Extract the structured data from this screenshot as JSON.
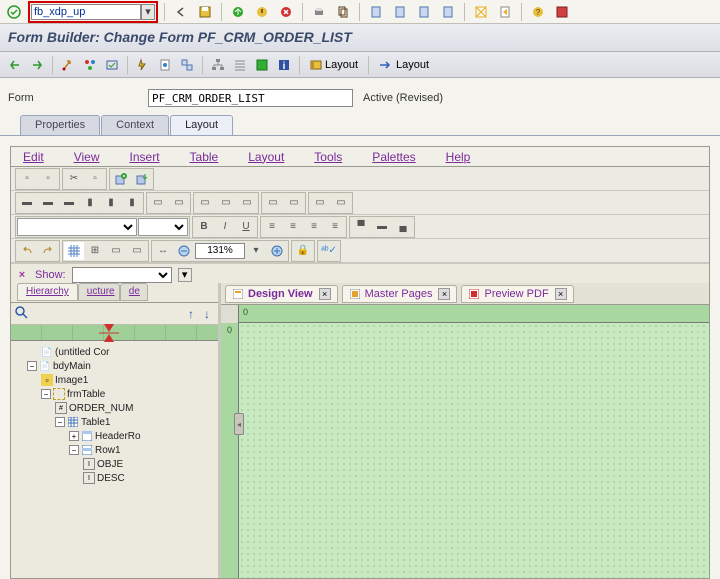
{
  "cmd_input": "fb_xdp_up",
  "title": "Form Builder: Change Form PF_CRM_ORDER_LIST",
  "form": {
    "label": "Form",
    "value": "PF_CRM_ORDER_LIST",
    "status": "Active (Revised)"
  },
  "tabs": {
    "properties": "Properties",
    "context": "Context",
    "layout": "Layout"
  },
  "app_toolbar": {
    "layout_label": "Layout"
  },
  "menu": {
    "edit": "Edit",
    "view": "View",
    "insert": "Insert",
    "table": "Table",
    "layout": "Layout",
    "tools": "Tools",
    "palettes": "Palettes",
    "help": "Help"
  },
  "fmt": {
    "bold": "B",
    "italic": "I",
    "underline": "U"
  },
  "zoom": "131%",
  "show": {
    "label": "Show:"
  },
  "hierarchy": {
    "tabs": {
      "hierarchy": "Hierarchy",
      "structure": "ucture",
      "data": "de"
    },
    "nodes": {
      "root": "(untitled Cor",
      "bdy": "bdyMain",
      "image1": "Image1",
      "frm": "frmTable",
      "ordnum": "ORDER_NUM",
      "table1": "Table1",
      "headerr": "HeaderRo",
      "row1": "Row1",
      "obj": "OBJE",
      "desc": "DESC"
    }
  },
  "canvas_tabs": {
    "design": "Design View",
    "master": "Master Pages",
    "preview": "Preview PDF"
  },
  "ruler0": "0"
}
